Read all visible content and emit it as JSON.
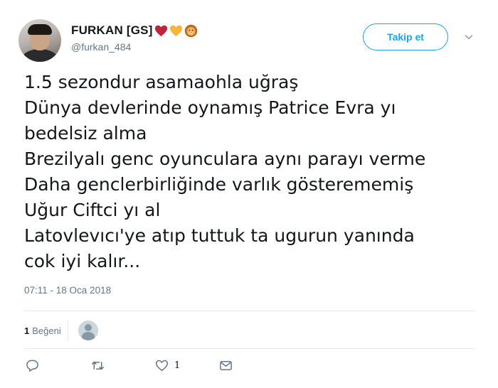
{
  "author": {
    "display_name": "FURKAN [GS]",
    "handle": "@furkan_484",
    "name_emojis": [
      "heart-red-icon",
      "heart-yellow-icon",
      "lion-face-icon"
    ]
  },
  "follow_button": {
    "label": "Takip et"
  },
  "tweet": {
    "lines": [
      "1.5 sezondur asamaohla uğraş",
      "Dünya devlerinde oynamış Patrice Evra yı",
      "bedelsiz alma",
      "Brezilyalı genc oyunculara aynı parayı verme",
      "Daha genclerbirliğinde varlık gösterememiş",
      "Uğur Ciftci yı al",
      "Latovlevıcı'ye atıp tuttuk ta ugurun yanında",
      "cok iyi kalır..."
    ],
    "timestamp": "07:11 - 18 Oca 2018"
  },
  "stats": {
    "likes_count": "1",
    "likes_label": "Beğeni"
  },
  "actions": {
    "reply_icon": "reply-icon",
    "retweet_icon": "retweet-icon",
    "like_icon": "heart-outline-icon",
    "like_count": "1",
    "dm_icon": "envelope-icon"
  },
  "colors": {
    "accent": "#1da1f2",
    "secondary_text": "#657786",
    "divider": "#e6ecf0",
    "heart_red": "#c0233b",
    "heart_yellow": "#f5b63a"
  }
}
